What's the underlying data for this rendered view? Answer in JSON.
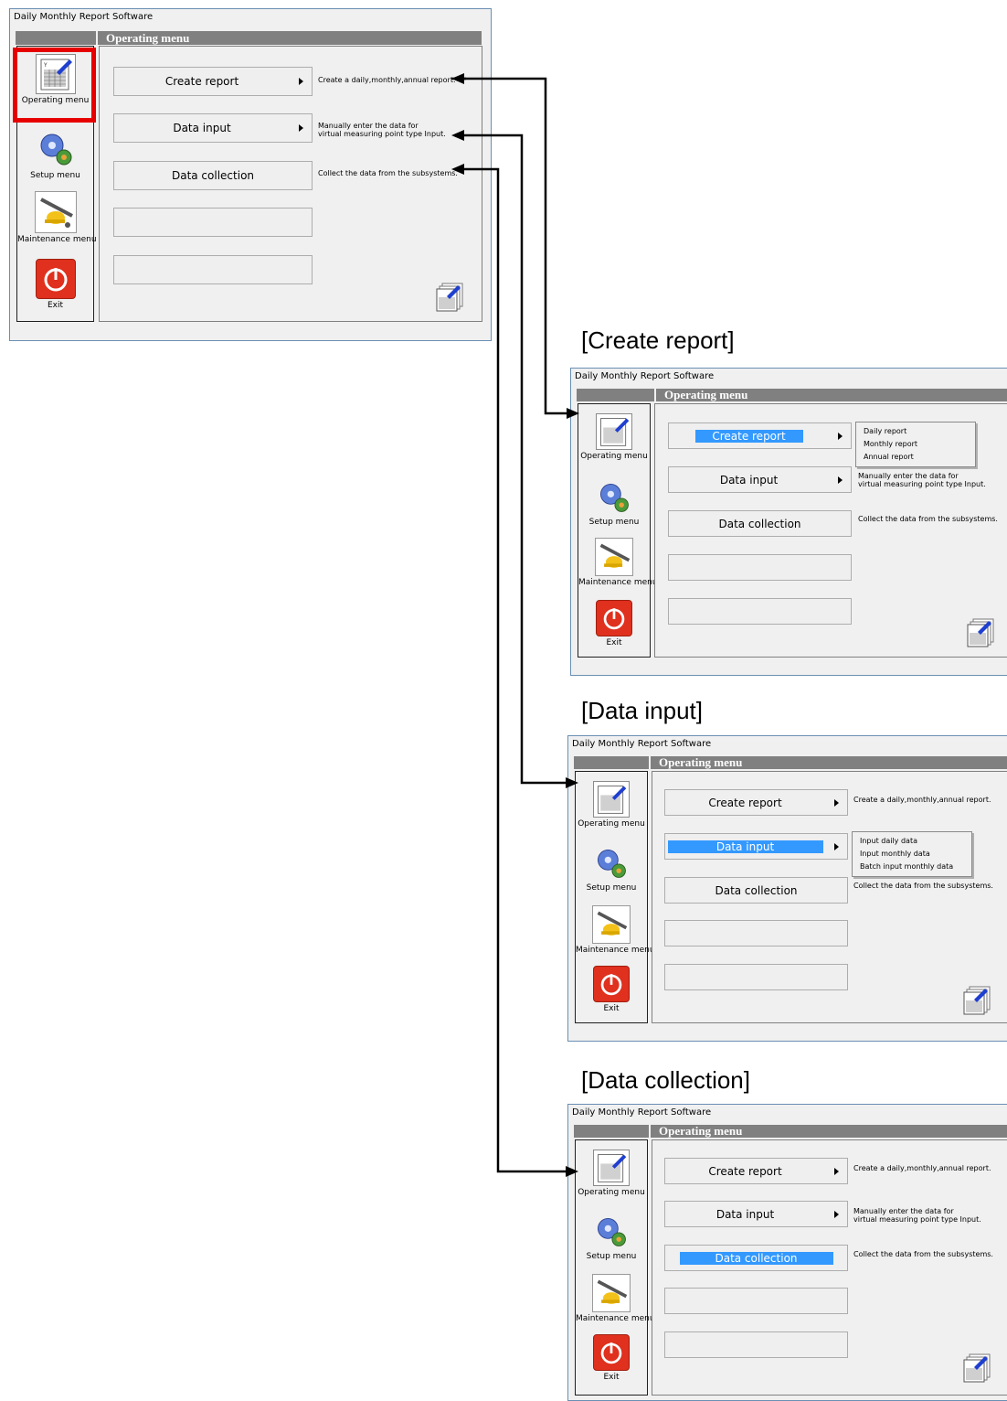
{
  "windows": [
    {
      "title": "Daily Monthly Report Software",
      "header": "Operating menu",
      "side": [
        "Operating menu",
        "Setup menu",
        "Maintenance menu",
        "Exit"
      ],
      "buttons": [
        "Create report",
        "Data input",
        "Data collection"
      ],
      "descriptions": {
        "create": "Create a daily,monthly,annual report.",
        "input_1": "Manually enter the data for",
        "input_2": "virtual measuring point type Input.",
        "collect": "Collect the data from the subsystems."
      }
    },
    {
      "section": "[Create report]",
      "title": "Daily Monthly Report Software",
      "header": "Operating menu",
      "side": [
        "Operating menu",
        "Setup menu",
        "Maintenance menu",
        "Exit"
      ],
      "buttons": [
        "Create report",
        "Data input",
        "Data collection"
      ],
      "popup": [
        "Daily report",
        "Monthly report",
        "Annual report"
      ],
      "descriptions": {
        "input_1": "Manually enter the data for",
        "input_2": "virtual measuring point type Input.",
        "collect": "Collect the data from the subsystems."
      }
    },
    {
      "section": "[Data input]",
      "title": "Daily Monthly Report Software",
      "header": "Operating menu",
      "side": [
        "Operating menu",
        "Setup menu",
        "Maintenance menu",
        "Exit"
      ],
      "buttons": [
        "Create report",
        "Data input",
        "Data collection"
      ],
      "popup": [
        "Input daily data",
        "Input monthly data",
        "Batch input monthly data"
      ],
      "descriptions": {
        "create": "Create a daily,monthly,annual report.",
        "collect": "Collect the data from the subsystems."
      }
    },
    {
      "section": "[Data collection]",
      "title": "Daily Monthly Report Software",
      "header": "Operating menu",
      "side": [
        "Operating menu",
        "Setup menu",
        "Maintenance menu",
        "Exit"
      ],
      "buttons": [
        "Create report",
        "Data input",
        "Data collection"
      ],
      "descriptions": {
        "create": "Create a daily,monthly,annual report.",
        "input_1": "Manually enter the data for",
        "input_2": "virtual measuring point type Input.",
        "collect": "Collect the data from the subsystems."
      }
    }
  ],
  "colors": {
    "highlight": "#3399ff",
    "header": "#808080",
    "redbox": "#e60000",
    "exit": "#e0301e"
  },
  "icons": [
    "calendar-report-icon",
    "gears-icon",
    "maintenance-tools-icon",
    "power-icon",
    "report-stack-icon"
  ]
}
